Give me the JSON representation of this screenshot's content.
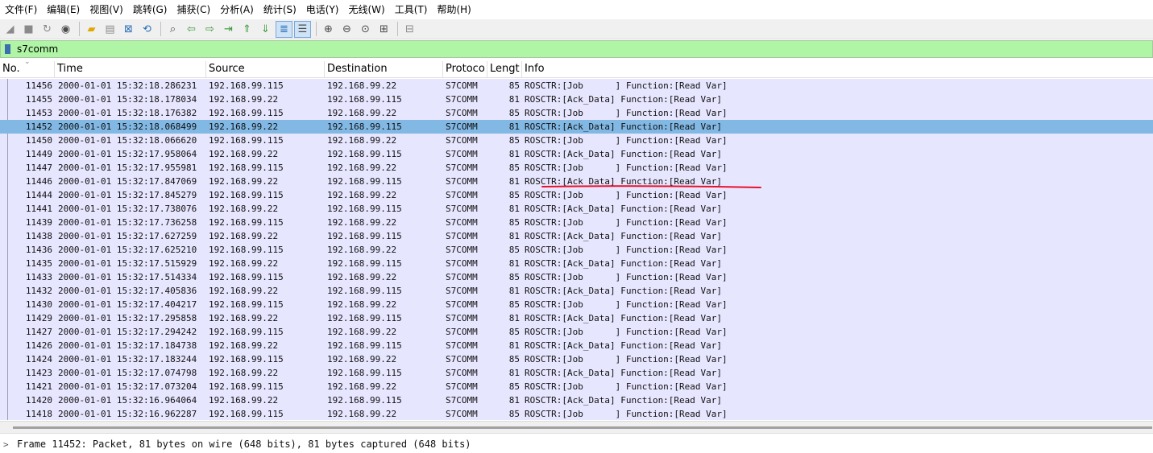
{
  "menu": [
    "文件(F)",
    "编辑(E)",
    "视图(V)",
    "跳转(G)",
    "捕获(C)",
    "分析(A)",
    "统计(S)",
    "电话(Y)",
    "无线(W)",
    "工具(T)",
    "帮助(H)"
  ],
  "toolbar_icons": [
    {
      "name": "shark-fin-start-icon",
      "glyph": "◢",
      "color": "#8a8a8a"
    },
    {
      "name": "stop-icon",
      "glyph": "■",
      "color": "#8a8a8a"
    },
    {
      "name": "restart-icon",
      "glyph": "↻",
      "color": "#8a8a8a"
    },
    {
      "name": "capture-options-icon",
      "glyph": "◉",
      "color": "#4a4a4a"
    },
    {
      "name": "open-folder-icon",
      "glyph": "▰",
      "color": "#e0a800"
    },
    {
      "name": "save-file-icon",
      "glyph": "▤",
      "color": "#8a8a8a"
    },
    {
      "name": "close-file-icon",
      "glyph": "⊠",
      "color": "#2a6fb8"
    },
    {
      "name": "reload-icon",
      "glyph": "⟲",
      "color": "#2a6fb8"
    },
    {
      "name": "find-packet-icon",
      "glyph": "⌕",
      "color": "#4a4a4a"
    },
    {
      "name": "go-back-icon",
      "glyph": "⇦",
      "color": "#3a9a3a"
    },
    {
      "name": "go-forward-icon",
      "glyph": "⇨",
      "color": "#3a9a3a"
    },
    {
      "name": "go-to-packet-icon",
      "glyph": "⇥",
      "color": "#3a9a3a"
    },
    {
      "name": "go-first-icon",
      "glyph": "⇑",
      "color": "#3a9a3a"
    },
    {
      "name": "go-last-icon",
      "glyph": "⇓",
      "color": "#3a9a3a"
    },
    {
      "name": "autoscroll-icon",
      "glyph": "≣",
      "color": "#2a6fb8"
    },
    {
      "name": "colorize-icon",
      "glyph": "☰",
      "color": "#4a4a4a"
    },
    {
      "name": "zoom-in-icon",
      "glyph": "⊕",
      "color": "#4a4a4a"
    },
    {
      "name": "zoom-out-icon",
      "glyph": "⊖",
      "color": "#4a4a4a"
    },
    {
      "name": "zoom-normal-icon",
      "glyph": "⊙",
      "color": "#4a4a4a"
    },
    {
      "name": "resize-columns-icon",
      "glyph": "⊞",
      "color": "#4a4a4a"
    },
    {
      "name": "layout-icon",
      "glyph": "⊟",
      "color": "#8a8a8a"
    }
  ],
  "filter": {
    "value": "s7comm"
  },
  "columns": [
    "No.",
    "Time",
    "Source",
    "Destination",
    "Protoco",
    "Lengt",
    "Info"
  ],
  "selected_no": "11452",
  "packets": [
    {
      "no": "11456",
      "time": "2000-01-01 15:32:18.286231",
      "src": "192.168.99.115",
      "dst": "192.168.99.22",
      "proto": "S7COMM",
      "len": "85",
      "info": "ROSCTR:[Job      ] Function:[Read Var]"
    },
    {
      "no": "11455",
      "time": "2000-01-01 15:32:18.178034",
      "src": "192.168.99.22",
      "dst": "192.168.99.115",
      "proto": "S7COMM",
      "len": "81",
      "info": "ROSCTR:[Ack_Data] Function:[Read Var]"
    },
    {
      "no": "11453",
      "time": "2000-01-01 15:32:18.176382",
      "src": "192.168.99.115",
      "dst": "192.168.99.22",
      "proto": "S7COMM",
      "len": "85",
      "info": "ROSCTR:[Job      ] Function:[Read Var]"
    },
    {
      "no": "11452",
      "time": "2000-01-01 15:32:18.068499",
      "src": "192.168.99.22",
      "dst": "192.168.99.115",
      "proto": "S7COMM",
      "len": "81",
      "info": "ROSCTR:[Ack_Data] Function:[Read Var]"
    },
    {
      "no": "11450",
      "time": "2000-01-01 15:32:18.066620",
      "src": "192.168.99.115",
      "dst": "192.168.99.22",
      "proto": "S7COMM",
      "len": "85",
      "info": "ROSCTR:[Job      ] Function:[Read Var]"
    },
    {
      "no": "11449",
      "time": "2000-01-01 15:32:17.958064",
      "src": "192.168.99.22",
      "dst": "192.168.99.115",
      "proto": "S7COMM",
      "len": "81",
      "info": "ROSCTR:[Ack_Data] Function:[Read Var]"
    },
    {
      "no": "11447",
      "time": "2000-01-01 15:32:17.955981",
      "src": "192.168.99.115",
      "dst": "192.168.99.22",
      "proto": "S7COMM",
      "len": "85",
      "info": "ROSCTR:[Job      ] Function:[Read Var]"
    },
    {
      "no": "11446",
      "time": "2000-01-01 15:32:17.847069",
      "src": "192.168.99.22",
      "dst": "192.168.99.115",
      "proto": "S7COMM",
      "len": "81",
      "info": "ROSCTR:[Ack_Data] Function:[Read Var]"
    },
    {
      "no": "11444",
      "time": "2000-01-01 15:32:17.845279",
      "src": "192.168.99.115",
      "dst": "192.168.99.22",
      "proto": "S7COMM",
      "len": "85",
      "info": "ROSCTR:[Job      ] Function:[Read Var]"
    },
    {
      "no": "11441",
      "time": "2000-01-01 15:32:17.738076",
      "src": "192.168.99.22",
      "dst": "192.168.99.115",
      "proto": "S7COMM",
      "len": "81",
      "info": "ROSCTR:[Ack_Data] Function:[Read Var]"
    },
    {
      "no": "11439",
      "time": "2000-01-01 15:32:17.736258",
      "src": "192.168.99.115",
      "dst": "192.168.99.22",
      "proto": "S7COMM",
      "len": "85",
      "info": "ROSCTR:[Job      ] Function:[Read Var]"
    },
    {
      "no": "11438",
      "time": "2000-01-01 15:32:17.627259",
      "src": "192.168.99.22",
      "dst": "192.168.99.115",
      "proto": "S7COMM",
      "len": "81",
      "info": "ROSCTR:[Ack_Data] Function:[Read Var]"
    },
    {
      "no": "11436",
      "time": "2000-01-01 15:32:17.625210",
      "src": "192.168.99.115",
      "dst": "192.168.99.22",
      "proto": "S7COMM",
      "len": "85",
      "info": "ROSCTR:[Job      ] Function:[Read Var]"
    },
    {
      "no": "11435",
      "time": "2000-01-01 15:32:17.515929",
      "src": "192.168.99.22",
      "dst": "192.168.99.115",
      "proto": "S7COMM",
      "len": "81",
      "info": "ROSCTR:[Ack_Data] Function:[Read Var]"
    },
    {
      "no": "11433",
      "time": "2000-01-01 15:32:17.514334",
      "src": "192.168.99.115",
      "dst": "192.168.99.22",
      "proto": "S7COMM",
      "len": "85",
      "info": "ROSCTR:[Job      ] Function:[Read Var]"
    },
    {
      "no": "11432",
      "time": "2000-01-01 15:32:17.405836",
      "src": "192.168.99.22",
      "dst": "192.168.99.115",
      "proto": "S7COMM",
      "len": "81",
      "info": "ROSCTR:[Ack_Data] Function:[Read Var]"
    },
    {
      "no": "11430",
      "time": "2000-01-01 15:32:17.404217",
      "src": "192.168.99.115",
      "dst": "192.168.99.22",
      "proto": "S7COMM",
      "len": "85",
      "info": "ROSCTR:[Job      ] Function:[Read Var]"
    },
    {
      "no": "11429",
      "time": "2000-01-01 15:32:17.295858",
      "src": "192.168.99.22",
      "dst": "192.168.99.115",
      "proto": "S7COMM",
      "len": "81",
      "info": "ROSCTR:[Ack_Data] Function:[Read Var]"
    },
    {
      "no": "11427",
      "time": "2000-01-01 15:32:17.294242",
      "src": "192.168.99.115",
      "dst": "192.168.99.22",
      "proto": "S7COMM",
      "len": "85",
      "info": "ROSCTR:[Job      ] Function:[Read Var]"
    },
    {
      "no": "11426",
      "time": "2000-01-01 15:32:17.184738",
      "src": "192.168.99.22",
      "dst": "192.168.99.115",
      "proto": "S7COMM",
      "len": "81",
      "info": "ROSCTR:[Ack_Data] Function:[Read Var]"
    },
    {
      "no": "11424",
      "time": "2000-01-01 15:32:17.183244",
      "src": "192.168.99.115",
      "dst": "192.168.99.22",
      "proto": "S7COMM",
      "len": "85",
      "info": "ROSCTR:[Job      ] Function:[Read Var]"
    },
    {
      "no": "11423",
      "time": "2000-01-01 15:32:17.074798",
      "src": "192.168.99.22",
      "dst": "192.168.99.115",
      "proto": "S7COMM",
      "len": "81",
      "info": "ROSCTR:[Ack_Data] Function:[Read Var]"
    },
    {
      "no": "11421",
      "time": "2000-01-01 15:32:17.073204",
      "src": "192.168.99.115",
      "dst": "192.168.99.22",
      "proto": "S7COMM",
      "len": "85",
      "info": "ROSCTR:[Job      ] Function:[Read Var]"
    },
    {
      "no": "11420",
      "time": "2000-01-01 15:32:16.964064",
      "src": "192.168.99.22",
      "dst": "192.168.99.115",
      "proto": "S7COMM",
      "len": "81",
      "info": "ROSCTR:[Ack_Data] Function:[Read Var]"
    },
    {
      "no": "11418",
      "time": "2000-01-01 15:32:16.962287",
      "src": "192.168.99.115",
      "dst": "192.168.99.22",
      "proto": "S7COMM",
      "len": "85",
      "info": "ROSCTR:[Job      ] Function:[Read Var]"
    }
  ],
  "detail": {
    "summary": "Frame 11452: Packet, 81 bytes on wire (648 bits), 81 bytes captured (648 bits)"
  },
  "colors": {
    "row_bg": "#e7e6ff",
    "selected_bg": "#82b8e4",
    "filter_bg": "#aff5a5",
    "annotation": "#e8122a"
  }
}
